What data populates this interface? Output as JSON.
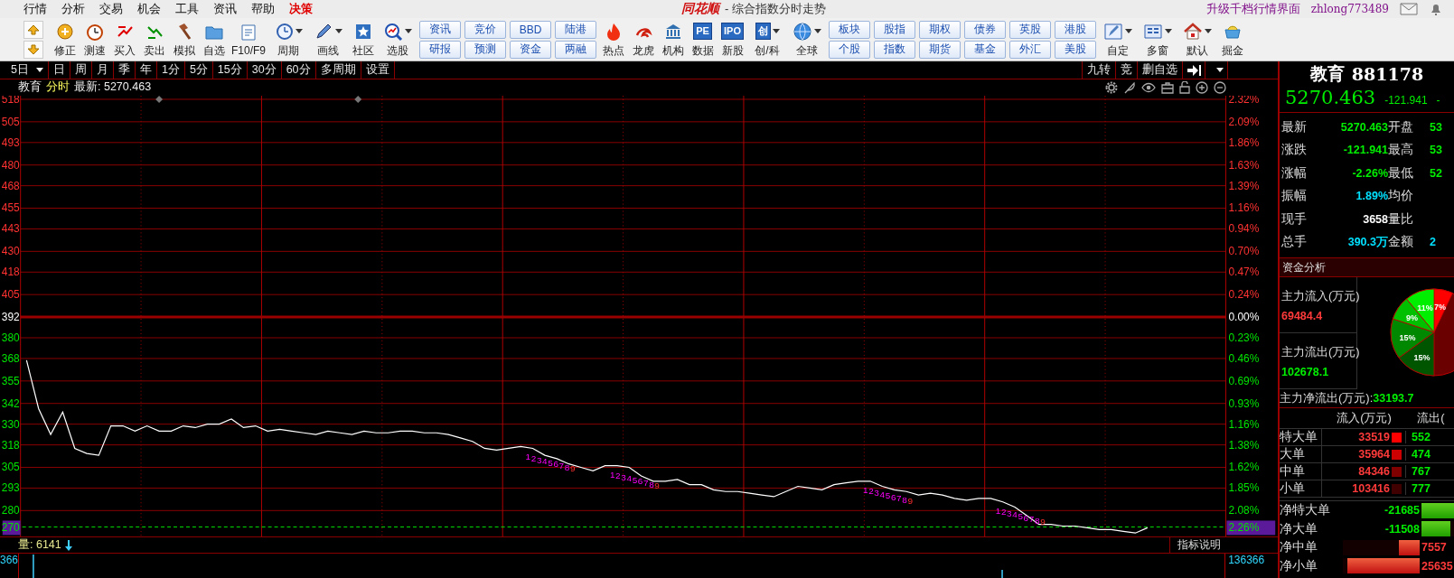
{
  "menu": {
    "items": [
      {
        "label": "行情",
        "highlight": false
      },
      {
        "label": "分析",
        "highlight": false
      },
      {
        "label": "交易",
        "highlight": false
      },
      {
        "label": "机会",
        "highlight": false
      },
      {
        "label": "工具",
        "highlight": false
      },
      {
        "label": "资讯",
        "highlight": false
      },
      {
        "label": "帮助",
        "highlight": false
      },
      {
        "label": "决策",
        "highlight": true
      }
    ]
  },
  "title": {
    "logo": "同花顺",
    "text": "- 综合指数分时走势"
  },
  "account": {
    "upgrade_link": "升级千档行情界面",
    "username": "zhlong773489"
  },
  "toolbar": [
    {
      "kind": "arrows"
    },
    {
      "kind": "icon",
      "label": "修正",
      "dropdown": false
    },
    {
      "kind": "icon",
      "label": "测速",
      "dropdown": false
    },
    {
      "kind": "icon",
      "label": "买入",
      "dropdown": false
    },
    {
      "kind": "icon",
      "label": "卖出",
      "dropdown": false
    },
    {
      "kind": "icon",
      "label": "模拟",
      "dropdown": false
    },
    {
      "kind": "icon",
      "label": "自选",
      "dropdown": false
    },
    {
      "kind": "icon",
      "label": "F10/F9",
      "dropdown": false
    },
    {
      "kind": "icon",
      "label": "周期",
      "dropdown": true
    },
    {
      "kind": "icon",
      "label": "画线",
      "dropdown": true
    },
    {
      "kind": "icon",
      "label": "社区",
      "dropdown": false
    },
    {
      "kind": "icon",
      "label": "选股",
      "dropdown": true
    },
    {
      "kind": "pair",
      "top": "资讯",
      "bottom": "研报"
    },
    {
      "kind": "pair",
      "top": "竞价",
      "bottom": "预测"
    },
    {
      "kind": "pair",
      "top": "BBD",
      "bottom": "资金"
    },
    {
      "kind": "pair",
      "top": "陆港",
      "bottom": "两融"
    },
    {
      "kind": "icon",
      "label": "热点",
      "dropdown": false
    },
    {
      "kind": "icon",
      "label": "龙虎",
      "dropdown": false
    },
    {
      "kind": "icon",
      "label": "机构",
      "dropdown": false
    },
    {
      "kind": "icon",
      "label": "数据",
      "dropdown": false,
      "badge": "PE"
    },
    {
      "kind": "icon",
      "label": "新股",
      "dropdown": false,
      "badge": "IPO"
    },
    {
      "kind": "icon",
      "label": "创/科",
      "dropdown": true,
      "badge": "创"
    },
    {
      "kind": "icon",
      "label": "全球",
      "dropdown": true
    },
    {
      "kind": "pair",
      "top": "板块",
      "bottom": "个股"
    },
    {
      "kind": "pair",
      "top": "股指",
      "bottom": "指数"
    },
    {
      "kind": "pair",
      "top": "期权",
      "bottom": "期货"
    },
    {
      "kind": "pair",
      "top": "债券",
      "bottom": "基金"
    },
    {
      "kind": "pair",
      "top": "英股",
      "bottom": "外汇"
    },
    {
      "kind": "pair",
      "top": "港股",
      "bottom": "美股"
    },
    {
      "kind": "icon",
      "label": "自定",
      "dropdown": true
    },
    {
      "kind": "icon",
      "label": "多窗",
      "dropdown": true
    },
    {
      "kind": "icon",
      "label": "默认",
      "dropdown": true
    },
    {
      "kind": "icon",
      "label": "掘金",
      "dropdown": false
    }
  ],
  "period_bar": {
    "periods": [
      {
        "label": "5日",
        "dropdown": true
      },
      {
        "label": "日",
        "dropdown": false
      },
      {
        "label": "周",
        "dropdown": false
      },
      {
        "label": "月",
        "dropdown": false
      },
      {
        "label": "季",
        "dropdown": false
      },
      {
        "label": "年",
        "dropdown": false
      },
      {
        "label": "1分",
        "dropdown": false
      },
      {
        "label": "5分",
        "dropdown": false
      },
      {
        "label": "15分",
        "dropdown": false
      },
      {
        "label": "30分",
        "dropdown": false
      },
      {
        "label": "60分",
        "dropdown": false
      },
      {
        "label": "多周期",
        "dropdown": false
      },
      {
        "label": "设置",
        "dropdown": false
      }
    ],
    "right_items": [
      "九转",
      "竞",
      "删自选"
    ]
  },
  "chart_header": {
    "mode": "分时",
    "latest": "最新: 5270.463"
  },
  "chart": {
    "chart_data": {
      "type": "line",
      "ylim": [
        266,
        518
      ],
      "grid": true,
      "ref_lines": [
        {
          "axis": "y",
          "value": 392
        },
        {
          "axis": "y",
          "value": 270.5
        }
      ],
      "yticks": [
        518,
        505,
        493,
        480,
        468,
        455,
        443,
        430,
        418,
        405,
        392,
        380,
        368,
        355,
        342,
        330,
        318,
        305,
        293,
        280
      ],
      "categories": [
        null,
        null,
        null,
        null,
        null,
        null,
        null,
        null,
        null,
        null,
        null,
        null,
        null,
        null,
        null,
        null,
        null,
        null,
        null,
        null,
        null,
        null,
        null,
        null,
        null,
        null,
        null,
        null,
        null,
        null,
        null,
        null,
        null,
        null,
        null,
        null,
        null,
        null,
        null,
        null,
        null,
        null,
        null,
        null,
        null,
        null,
        null,
        null,
        null,
        null,
        null,
        null,
        null,
        null,
        null,
        null,
        null,
        null,
        null,
        null,
        null,
        null,
        null,
        null,
        null,
        null,
        null,
        null,
        null,
        null,
        null,
        null,
        null,
        null,
        null,
        null,
        null,
        null,
        null,
        null,
        null,
        null,
        null,
        null,
        null,
        null,
        null,
        null,
        null,
        null,
        null,
        null,
        null,
        null,
        null,
        null,
        null,
        null,
        null,
        null
      ],
      "series": [
        {
          "name": "教育",
          "color": "#ffffff",
          "values": [
            367,
            339,
            324,
            337,
            316,
            313,
            312,
            329,
            329,
            326,
            329,
            326,
            326,
            329,
            328,
            330,
            330,
            333,
            328,
            329,
            326,
            327,
            326,
            325,
            324,
            326,
            325,
            324,
            326,
            325,
            325,
            326,
            326,
            325,
            325,
            324,
            322,
            320,
            316,
            315,
            316,
            317,
            316,
            312,
            310,
            307,
            305,
            303,
            306,
            306,
            305,
            300,
            297,
            297,
            298,
            295,
            295,
            292,
            291,
            291,
            290,
            289,
            288,
            291,
            294,
            293,
            292,
            295,
            296,
            297,
            297,
            294,
            292,
            291,
            289,
            290,
            289,
            287,
            286,
            287,
            287,
            285,
            282,
            277,
            272,
            272,
            271,
            271,
            270,
            269,
            269,
            268,
            267,
            270,
            null,
            null,
            null,
            null,
            null,
            null
          ]
        }
      ],
      "annotations": [
        {
          "text": "123456789"
        },
        {
          "text": "123456789"
        },
        {
          "text": "123456789"
        },
        {
          "text": "123456789"
        }
      ]
    },
    "percent_ticks": [
      {
        "label": "2.32%",
        "color": "#ff3232"
      },
      {
        "label": "2.09%",
        "color": "#ff3232"
      },
      {
        "label": "1.86%",
        "color": "#ff3232"
      },
      {
        "label": "1.63%",
        "color": "#ff3232"
      },
      {
        "label": "1.39%",
        "color": "#ff3232"
      },
      {
        "label": "1.16%",
        "color": "#ff3232"
      },
      {
        "label": "0.94%",
        "color": "#ff3232"
      },
      {
        "label": "0.70%",
        "color": "#ff3232"
      },
      {
        "label": "0.47%",
        "color": "#ff3232"
      },
      {
        "label": "0.24%",
        "color": "#ff3232"
      },
      {
        "label": "0.00%",
        "color": "#ffffff"
      },
      {
        "label": "0.23%",
        "color": "#00e600"
      },
      {
        "label": "0.46%",
        "color": "#00e600"
      },
      {
        "label": "0.69%",
        "color": "#00e600"
      },
      {
        "label": "0.93%",
        "color": "#00e600"
      },
      {
        "label": "1.16%",
        "color": "#00e600"
      },
      {
        "label": "1.38%",
        "color": "#00e600"
      },
      {
        "label": "1.62%",
        "color": "#00e600"
      },
      {
        "label": "1.85%",
        "color": "#00e600"
      },
      {
        "label": "2.08%",
        "color": "#00e600"
      }
    ],
    "current_price": {
      "left_label": "270",
      "right_label": "2.26%"
    }
  },
  "volume": {
    "label": "量: 6141",
    "falling": true,
    "left_tick": "366",
    "right_tick": "136366",
    "button": "指标说明"
  },
  "quote": {
    "name": "教育",
    "code": "881178",
    "price": "5270.463",
    "change": "-121.941",
    "change_pct": "-"
  },
  "stats": [
    {
      "label": "最新",
      "value": "5270.463",
      "color": "#00ee00"
    },
    {
      "label": "开盘",
      "value": "53",
      "color": "#00ee00"
    },
    {
      "label": "涨跌",
      "value": "-121.941",
      "color": "#00ee00"
    },
    {
      "label": "最高",
      "value": "53",
      "color": "#00ee00"
    },
    {
      "label": "涨幅",
      "value": "-2.26%",
      "color": "#00ee00"
    },
    {
      "label": "最低",
      "value": "52",
      "color": "#00ee00"
    },
    {
      "label": "振幅",
      "value": "1.89%",
      "color": "#00e0ff"
    },
    {
      "label": "均价"
    },
    {
      "label": "现手",
      "value": "3658",
      "color": "#ffffff"
    },
    {
      "label": "量比"
    },
    {
      "label": "总手",
      "value": "390.3万",
      "color": "#00e0ff"
    },
    {
      "label": "金额",
      "value": "2",
      "color": "#00e0ff"
    }
  ],
  "fund_analysis": {
    "title": "资金分析",
    "inflow_label": "主力流入(万元)",
    "inflow": "69484.4",
    "outflow_label": "主力流出(万元)",
    "outflow": "102678.1",
    "net_label": "主力净流出(万元):",
    "net": "33193.7",
    "chart_data": {
      "type": "pie",
      "values": [
        7,
        11,
        9,
        15,
        15
      ],
      "colors": [
        "#ff0000",
        "#00ee00",
        "#00c000",
        "#008800",
        "#005500"
      ],
      "value_labels": [
        "7%",
        "11%",
        "9%",
        "15%",
        "15%"
      ]
    }
  },
  "orders": {
    "columns": [
      "流入(万元)",
      "流出("
    ],
    "rows": [
      {
        "label": "特大单",
        "inflow": "33519",
        "color": "#ff0000",
        "outflow": "552"
      },
      {
        "label": "大单",
        "inflow": "35964",
        "color": "#cc0000",
        "outflow": "474"
      },
      {
        "label": "中单",
        "inflow": "84346",
        "color": "#800000",
        "outflow": "767"
      },
      {
        "label": "小单",
        "inflow": "103416",
        "color": "#400000",
        "outflow": "777"
      }
    ]
  },
  "net_orders": [
    {
      "label": "净特大单",
      "value": "-21685",
      "kind": "out",
      "level": 0.97
    },
    {
      "label": "净大单",
      "value": "-11508",
      "kind": "out",
      "level": 0.85
    },
    {
      "label": "净中单",
      "value": "7557",
      "kind": "in",
      "level": 0.27
    },
    {
      "label": "净小单",
      "value": "25635",
      "kind": "in",
      "level": 0.94
    }
  ]
}
